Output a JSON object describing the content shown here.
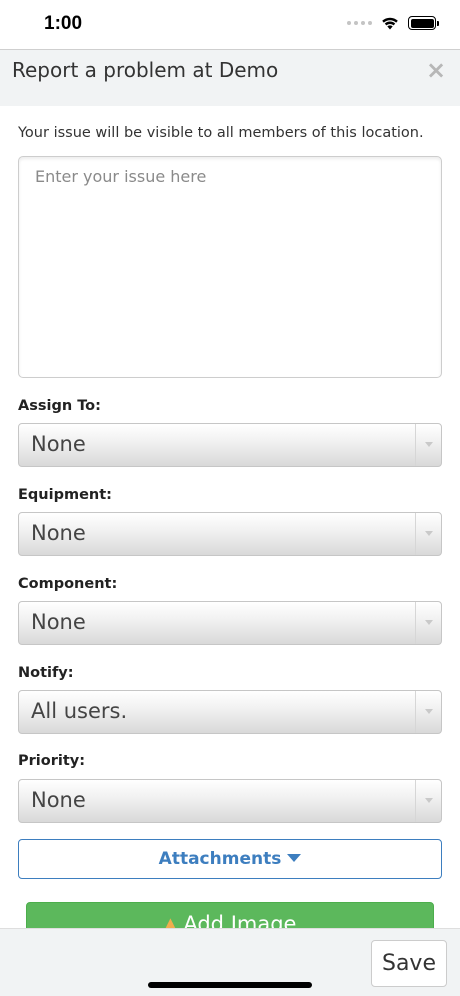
{
  "status_bar": {
    "time": "1:00"
  },
  "modal": {
    "title": "Report a problem at Demo",
    "close_glyph": "×",
    "notice": "Your issue will be visible to all members of this location.",
    "issue_placeholder": "Enter your issue here",
    "fields": [
      {
        "label": "Assign To:",
        "value": "None"
      },
      {
        "label": "Equipment:",
        "value": "None"
      },
      {
        "label": "Component:",
        "value": "None"
      },
      {
        "label": "Notify:",
        "value": "All users."
      },
      {
        "label": "Priority:",
        "value": "None"
      }
    ],
    "attachments_label": "Attachments",
    "add_image_label": "Add Image"
  },
  "footer": {
    "save_label": "Save"
  },
  "colors": {
    "accent_blue": "#3d7ebf",
    "success_green": "#5cb85c"
  }
}
